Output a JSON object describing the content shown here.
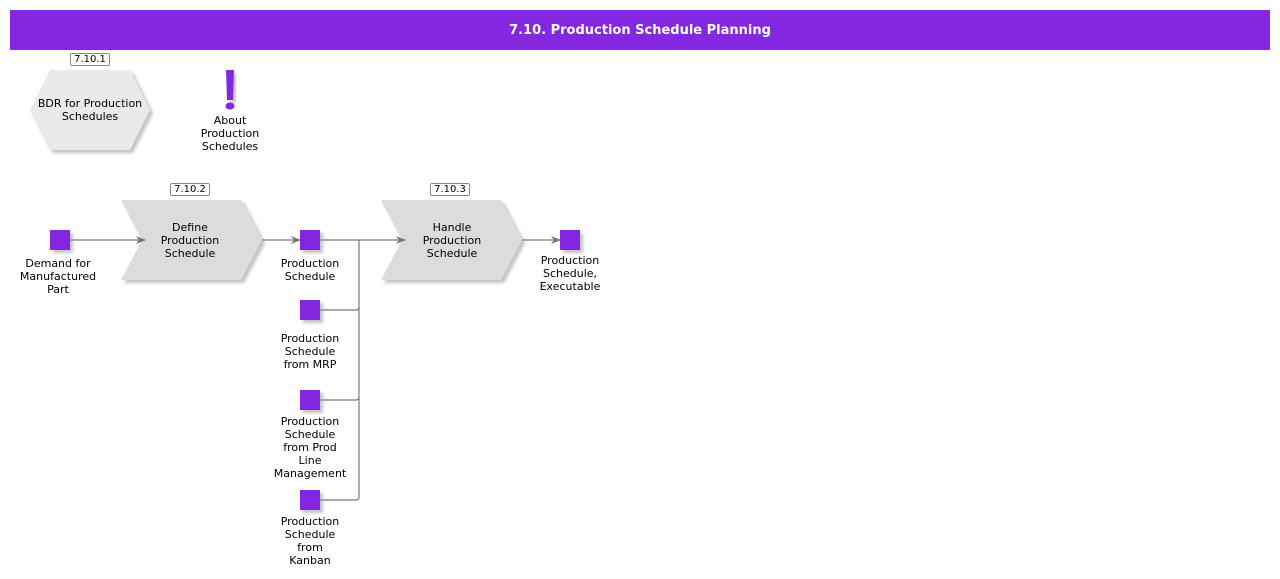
{
  "title": "7.10. Production Schedule Planning",
  "colors": {
    "header": "#8427e0",
    "event": "#8427e0",
    "process_fill": "#dcdcdc",
    "hex_fill": "#eaeaea",
    "connector": "#777777"
  },
  "nodes": {
    "bdr": {
      "id": "7.10.1",
      "label": "BDR for Production\nSchedules",
      "shape": "hexagon"
    },
    "about": {
      "label": "About\nProduction\nSchedules",
      "icon": "exclamation-icon"
    },
    "define": {
      "id": "7.10.2",
      "label": "Define\nProduction\nSchedule",
      "shape": "chevron"
    },
    "handle": {
      "id": "7.10.3",
      "label": "Handle\nProduction\nSchedule",
      "shape": "chevron"
    },
    "demand": {
      "label": "Demand for\nManufactured\nPart"
    },
    "prod_schedule": {
      "label": "Production\nSchedule"
    },
    "from_mrp": {
      "label": "Production\nSchedule\nfrom MRP"
    },
    "from_prod_line": {
      "label": "Production\nSchedule\nfrom Prod\nLine\nManagement"
    },
    "from_kanban": {
      "label": "Production\nSchedule\nfrom\nKanban"
    },
    "executable": {
      "label": "Production\nSchedule,\nExecutable"
    }
  }
}
